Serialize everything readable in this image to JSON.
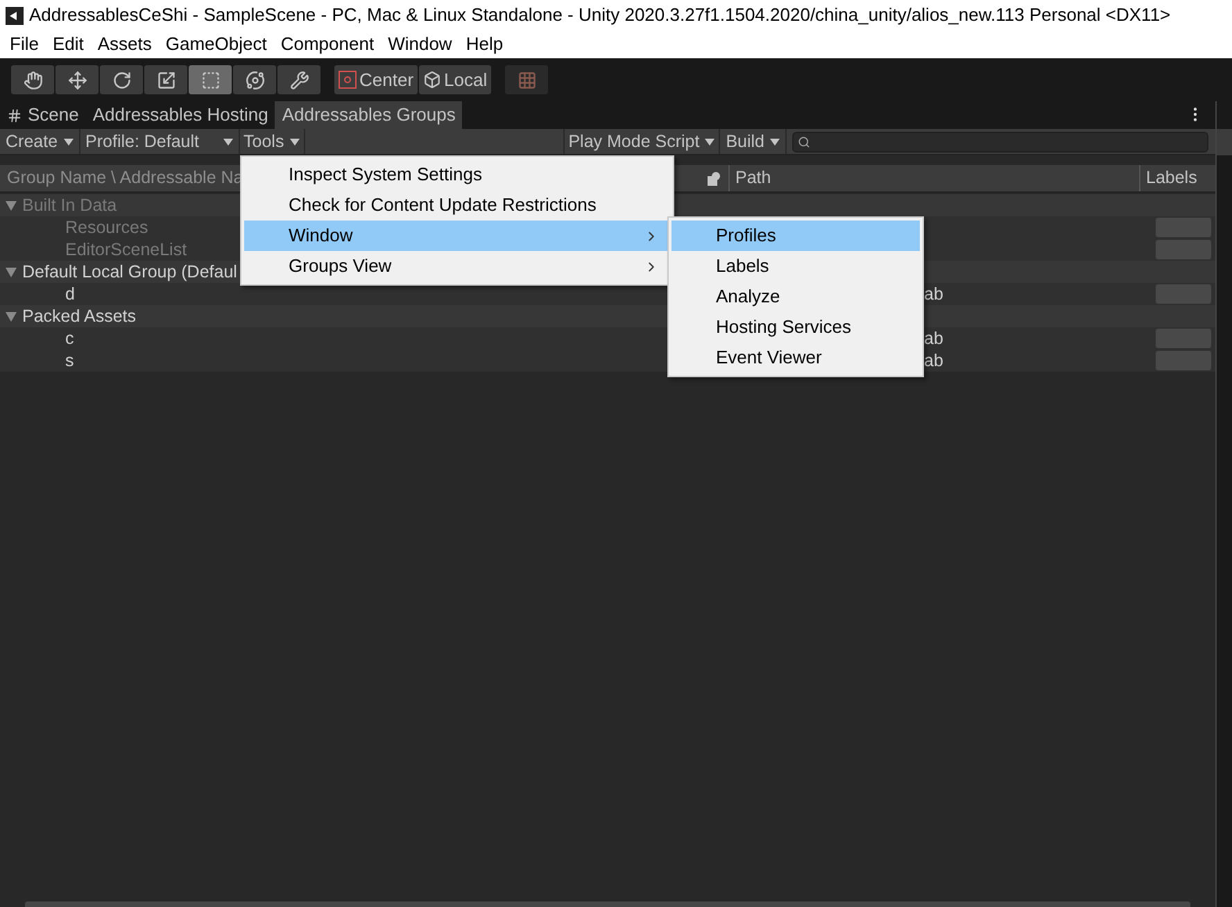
{
  "window": {
    "title": "AddressablesCeShi - SampleScene - PC, Mac & Linux Standalone - Unity 2020.3.27f1.1504.2020/china_unity/alios_new.113 Personal <DX11>"
  },
  "menu_bar": [
    "File",
    "Edit",
    "Assets",
    "GameObject",
    "Component",
    "Window",
    "Help"
  ],
  "tool_buttons": [
    {
      "kind": "hand",
      "selected": false
    },
    {
      "kind": "move",
      "selected": false
    },
    {
      "kind": "rotate",
      "selected": false
    },
    {
      "kind": "scale",
      "selected": false
    },
    {
      "kind": "rect",
      "selected": true
    },
    {
      "kind": "transform",
      "selected": false
    },
    {
      "kind": "custom",
      "selected": false
    }
  ],
  "pivot_buttons": [
    {
      "kind": "center",
      "label": "Center"
    },
    {
      "kind": "local",
      "label": "Local"
    }
  ],
  "tabs": [
    {
      "label": "Scene",
      "kind": "scene",
      "selected": false
    },
    {
      "label": "Addressables Hosting",
      "kind": "plain",
      "selected": false
    },
    {
      "label": "Addressables Groups",
      "kind": "plain",
      "selected": true
    }
  ],
  "toolbar": {
    "create": "Create",
    "profile": "Profile: Default",
    "tools": "Tools",
    "play_mode": "Play Mode Script",
    "build": "Build"
  },
  "columns": {
    "name": "Group Name \\ Addressable Na",
    "path": "Path",
    "labels": "Labels"
  },
  "groups": [
    {
      "name": "Built In Data",
      "expanded": true,
      "disabled": true,
      "children": [
        {
          "name": "Resources"
        },
        {
          "name": "EditorSceneList"
        }
      ]
    },
    {
      "name": "Default Local Group (Defaul",
      "expanded": true,
      "disabled": false,
      "children": [
        {
          "name": "d",
          "path": "ab"
        }
      ]
    },
    {
      "name": "Packed Assets",
      "expanded": true,
      "disabled": false,
      "children": [
        {
          "name": "c",
          "path": "ab"
        },
        {
          "name": "s",
          "path": "ab"
        }
      ]
    }
  ],
  "tools_menu": [
    {
      "label": "Inspect System Settings",
      "submenu": false,
      "selected": false
    },
    {
      "label": "Check for Content Update Restrictions",
      "submenu": false,
      "selected": false
    },
    {
      "label": "Window",
      "submenu": true,
      "selected": true
    },
    {
      "label": "Groups View",
      "submenu": true,
      "selected": false
    }
  ],
  "window_submenu": [
    {
      "label": "Profiles",
      "selected": true
    },
    {
      "label": "Labels",
      "selected": false
    },
    {
      "label": "Analyze",
      "selected": false
    },
    {
      "label": "Hosting Services",
      "selected": false
    },
    {
      "label": "Event Viewer",
      "selected": false
    }
  ]
}
